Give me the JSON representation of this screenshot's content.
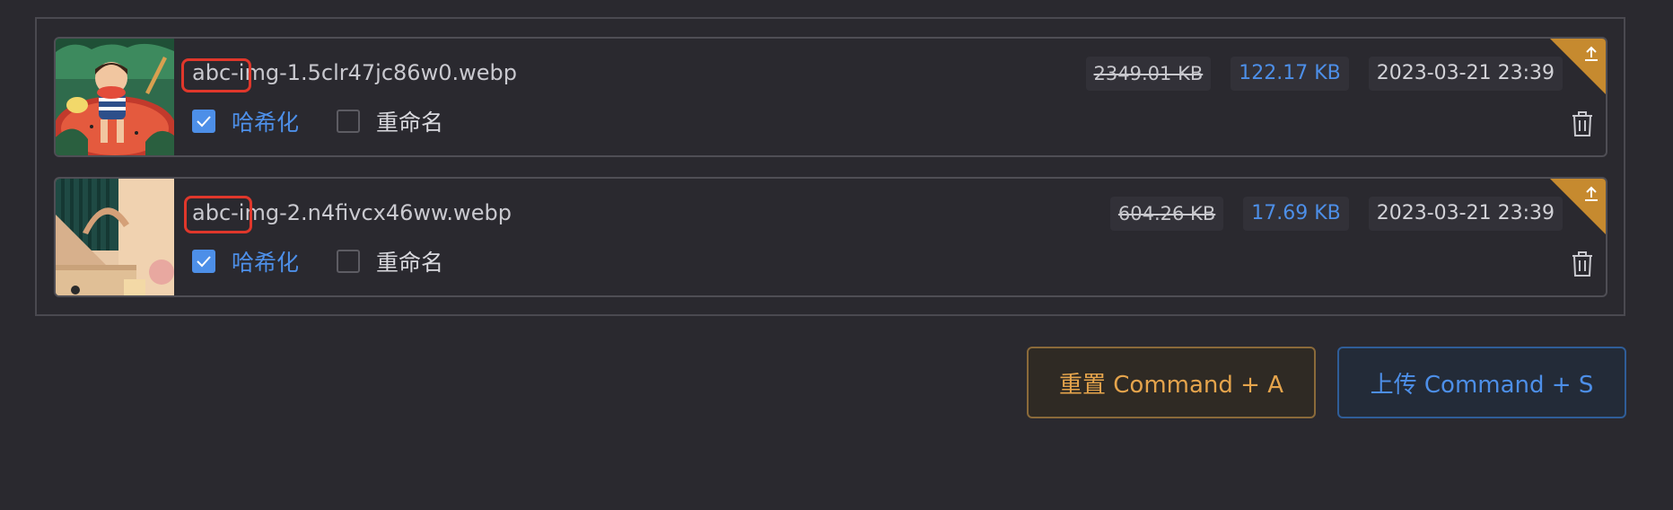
{
  "files": [
    {
      "name": "abc-img-1.5clr47jc86w0.webp",
      "original_size": "2349.01 KB",
      "compressed_size": "122.17 KB",
      "date": "2023-03-21 23:39",
      "options": [
        {
          "label": "哈希化",
          "checked": true
        },
        {
          "label": "重命名",
          "checked": false
        }
      ]
    },
    {
      "name": "abc-img-2.n4fivcx46ww.webp",
      "original_size": "604.26 KB",
      "compressed_size": "17.69 KB",
      "date": "2023-03-21 23:39",
      "options": [
        {
          "label": "哈希化",
          "checked": true
        },
        {
          "label": "重命名",
          "checked": false
        }
      ]
    }
  ],
  "actions": {
    "reset_label": "重置 Command + A",
    "upload_label": "上传 Command + S"
  },
  "colors": {
    "background": "#2a292f",
    "accent_blue": "#4d8fe8",
    "accent_orange": "#e5a44c",
    "corner_badge": "#c68a2f",
    "highlight_red": "#e0372b"
  },
  "icons": {
    "delete": "trash-icon",
    "upload": "upload-icon",
    "check": "check-icon"
  }
}
